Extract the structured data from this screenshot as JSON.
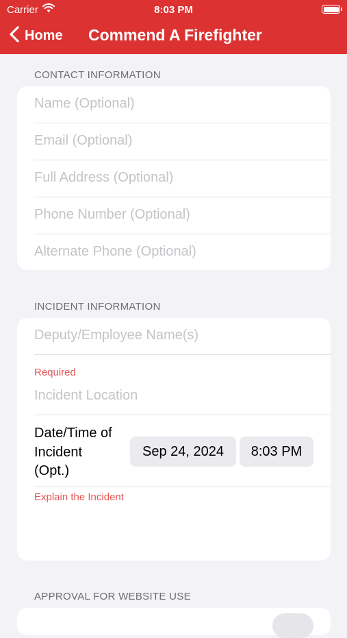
{
  "status_bar": {
    "carrier": "Carrier",
    "time": "8:03 PM"
  },
  "nav": {
    "back_label": "Home",
    "title": "Commend A Firefighter"
  },
  "contact": {
    "header": "CONTACT INFORMATION",
    "fields": [
      "Name (Optional)",
      "Email (Optional)",
      "Full Address (Optional)",
      "Phone Number (Optional)",
      "Alternate Phone (Optional)"
    ]
  },
  "incident": {
    "header": "INCIDENT INFORMATION",
    "employee_placeholder": "Deputy/Employee Name(s)",
    "required_label": "Required",
    "location_placeholder": "Incident Location",
    "datetime_label_1": "Date/Time of",
    "datetime_label_2": "Incident",
    "datetime_label_3": "(Opt.)",
    "date_value": "Sep 24, 2024",
    "time_value": "8:03 PM",
    "explain_label": "Explain the Incident"
  },
  "approval": {
    "header": "APPROVAL FOR WEBSITE USE"
  }
}
